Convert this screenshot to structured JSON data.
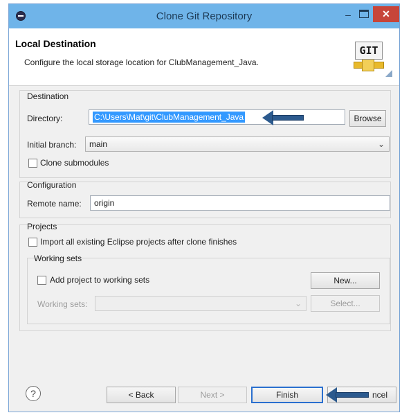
{
  "window": {
    "title": "Clone Git Repository",
    "minimize_glyph": "–",
    "close_glyph": "✕"
  },
  "header": {
    "title": "Local Destination",
    "description": "Configure the local storage location for ClubManagement_Java.",
    "logo_text": "GIT"
  },
  "destination": {
    "group_label": "Destination",
    "directory_label": "Directory:",
    "directory_value": "C:\\Users\\Mat\\git\\ClubManagement_Java",
    "browse_label": "Browse",
    "branch_label": "Initial branch:",
    "branch_value": "main",
    "clone_submodules_label": "Clone submodules"
  },
  "configuration": {
    "group_label": "Configuration",
    "remote_name_label": "Remote name:",
    "remote_name_value": "origin"
  },
  "projects": {
    "group_label": "Projects",
    "import_label": "Import all existing Eclipse projects after clone finishes",
    "working_sets_group_label": "Working sets",
    "add_project_label": "Add project to working sets",
    "new_button": "New...",
    "working_sets_label": "Working sets:",
    "select_button": "Select..."
  },
  "footer": {
    "help_glyph": "?",
    "back_button": "< Back",
    "next_button": "Next >",
    "finish_button": "Finish",
    "cancel_button": "Cancel",
    "cancel_visible_text": "ncel"
  },
  "colors": {
    "titlebar": "#6fb4e9",
    "selection": "#3399ff",
    "annotation_arrow": "#2c5a8e",
    "close_button": "#c7453a"
  },
  "icons": [
    "app-icon",
    "git-logo-icon",
    "help-icon",
    "chevron-down-icon",
    "annotation-arrow-icon"
  ]
}
